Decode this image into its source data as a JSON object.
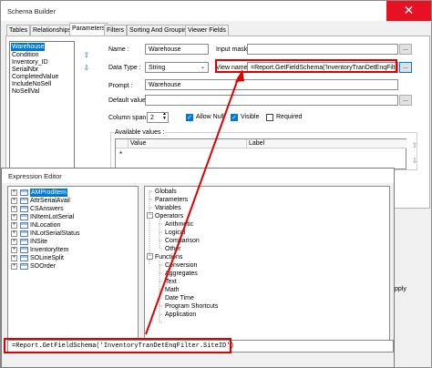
{
  "schema_builder": {
    "title": "Schema Builder",
    "close_label": "✕",
    "tabs": [
      {
        "label": "Tables"
      },
      {
        "label": "Relationships"
      },
      {
        "label": "Parameters"
      },
      {
        "label": "Filters"
      },
      {
        "label": "Sorting And Grouping"
      },
      {
        "label": "Viewer Fields"
      }
    ],
    "fields": [
      {
        "label": "Warehouse"
      },
      {
        "label": "Condition"
      },
      {
        "label": "Inventory_ID"
      },
      {
        "label": "SerialNbr"
      },
      {
        "label": "CompletedValue"
      },
      {
        "label": "IncludeNoSell"
      },
      {
        "label": "NoSellVal"
      }
    ],
    "form": {
      "name_label": "Name :",
      "name_value": "Warehouse",
      "input_mask_label": "Input mask :",
      "input_mask_value": "",
      "data_type_label": "Data Type :",
      "data_type_value": "String",
      "view_name_label": "View name :",
      "view_name_value": "=Report.GetFieldSchema('InventoryTranDetEnqFilter.SiteID')",
      "prompt_label": "Prompt :",
      "prompt_value": "Warehouse",
      "default_label": "Default value :",
      "default_value": "",
      "column_span_label": "Column span :",
      "column_span_value": "2",
      "allow_null_label": "Allow Null",
      "visible_label": "Visible",
      "required_label": "Required",
      "dots_label": "...",
      "available_values_label": "Available values :",
      "value_col": "Value",
      "label_col": "Label",
      "new_row_marker": "*"
    },
    "apply_label": "pply"
  },
  "expression_editor": {
    "title": "Expression Editor",
    "tables": [
      {
        "label": "AMProdItem"
      },
      {
        "label": "AttrSerialAvail"
      },
      {
        "label": "CSAnswers"
      },
      {
        "label": "INItemLotSerial"
      },
      {
        "label": "INLocation"
      },
      {
        "label": "INLotSerialStatus"
      },
      {
        "label": "INSite"
      },
      {
        "label": "InventoryItem"
      },
      {
        "label": "SOLineSplit"
      },
      {
        "label": "SOOrder"
      }
    ],
    "functions_tree": [
      {
        "label": "Globals"
      },
      {
        "label": "Parameters"
      },
      {
        "label": "Variables"
      },
      {
        "label": "Operators"
      },
      {
        "label": "Arithmetic"
      },
      {
        "label": "Logical"
      },
      {
        "label": "Comparison"
      },
      {
        "label": "Other"
      },
      {
        "label": "Functions"
      },
      {
        "label": "Conversion"
      },
      {
        "label": "Aggregates"
      },
      {
        "label": "Text"
      },
      {
        "label": "Math"
      },
      {
        "label": "Date Time"
      },
      {
        "label": "Program Shortcuts"
      },
      {
        "label": "Application"
      }
    ],
    "expression": "=Report.GetFieldSchema('InventoryTranDetEnqFilter.SiteID')"
  },
  "colors": {
    "selection": "#0078d7",
    "annotation": "#e00000",
    "close": "#e81123"
  }
}
